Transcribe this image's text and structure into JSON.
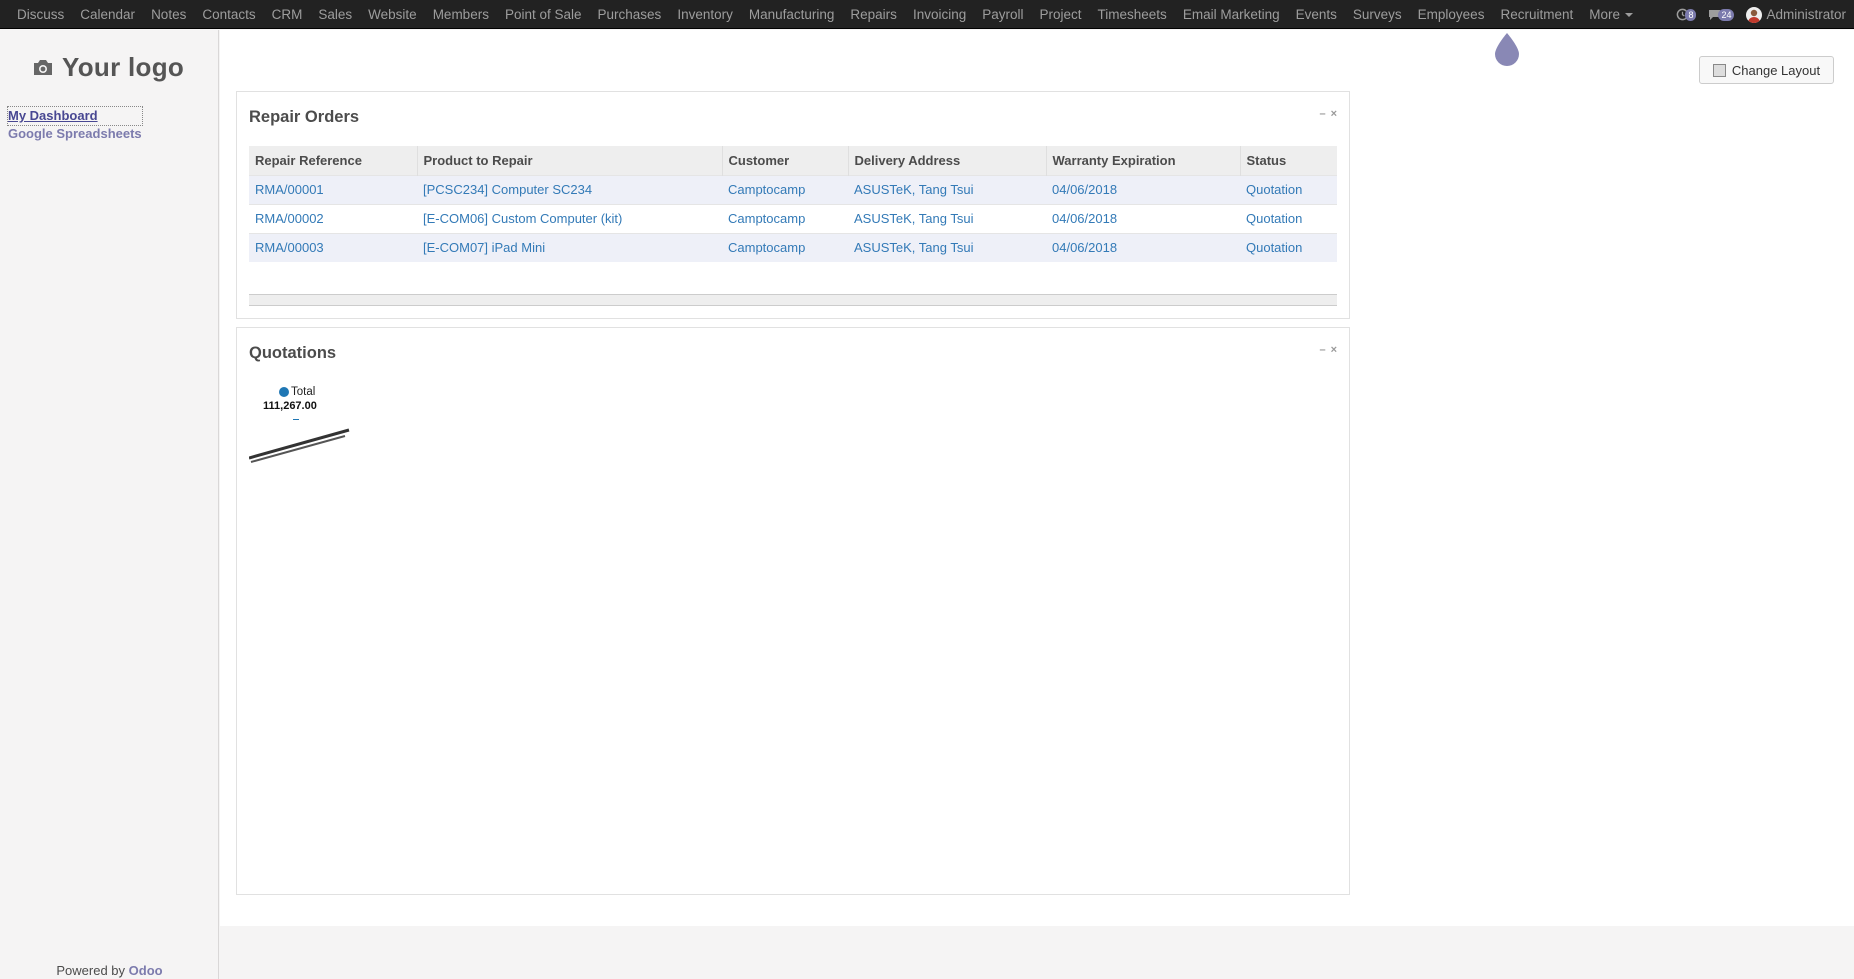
{
  "topbar": {
    "menu": [
      "Discuss",
      "Calendar",
      "Notes",
      "Contacts",
      "CRM",
      "Sales",
      "Website",
      "Members",
      "Point of Sale",
      "Purchases",
      "Inventory",
      "Manufacturing",
      "Repairs",
      "Invoicing",
      "Payroll",
      "Project",
      "Timesheets",
      "Email Marketing",
      "Events",
      "Surveys",
      "Employees",
      "Recruitment",
      "More"
    ],
    "activity_count": "8",
    "messages_count": "24",
    "user": "Administrator"
  },
  "sidebar": {
    "logo_text": "Your logo",
    "links": [
      "My Dashboard",
      "Google Spreadsheets"
    ],
    "powered_by": "Powered by",
    "brand": "Odoo"
  },
  "main": {
    "change_layout": "Change Layout"
  },
  "repair": {
    "title": "Repair Orders",
    "columns": [
      "Repair Reference",
      "Product to Repair",
      "Customer",
      "Delivery Address",
      "Warranty Expiration",
      "Status"
    ],
    "rows": [
      [
        "RMA/00001",
        "[PCSC234] Computer SC234",
        "Camptocamp",
        "ASUSTeK, Tang Tsui",
        "04/06/2018",
        "Quotation"
      ],
      [
        "RMA/00002",
        "[E-COM06] Custom Computer (kit)",
        "Camptocamp",
        "ASUSTeK, Tang Tsui",
        "04/06/2018",
        "Quotation"
      ],
      [
        "RMA/00003",
        "[E-COM07] iPad Mini",
        "Camptocamp",
        "ASUSTeK, Tang Tsui",
        "04/06/2018",
        "Quotation"
      ]
    ]
  },
  "quotations": {
    "title": "Quotations"
  },
  "chart_data": {
    "type": "bar",
    "series": [
      {
        "name": "Total",
        "values": [
          111267
        ]
      }
    ],
    "value_label": "111,267.00",
    "title": "",
    "xlabel": "",
    "ylabel": "",
    "legend": "top"
  },
  "colors": {
    "topbar": "#222222",
    "accent": "#7c7bad",
    "link": "#337ab7",
    "series": "#1f77b4"
  }
}
